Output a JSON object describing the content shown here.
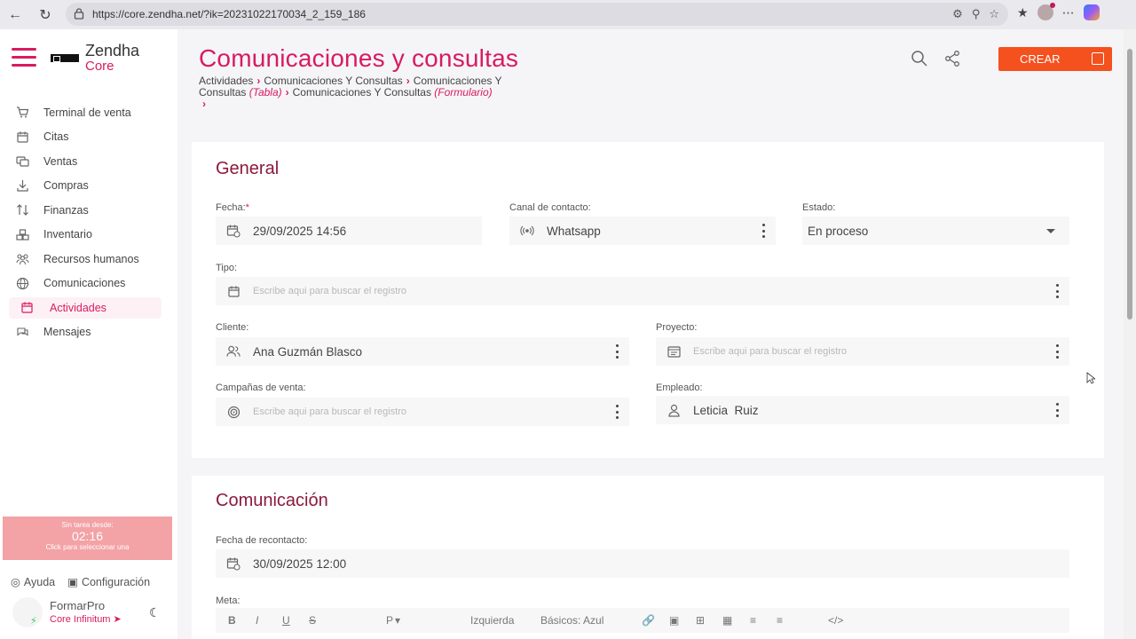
{
  "browser": {
    "url": "https://core.zendha.net/?ik=20231022170034_2_159_186"
  },
  "app": {
    "brand_name": "Zendha",
    "brand_sub": "Core"
  },
  "sidebar": {
    "items": [
      {
        "label": "Terminal de venta",
        "icon": "cart-icon"
      },
      {
        "label": "Citas",
        "icon": "calendar-icon"
      },
      {
        "label": "Ventas",
        "icon": "sales-icon"
      },
      {
        "label": "Compras",
        "icon": "download-icon"
      },
      {
        "label": "Finanzas",
        "icon": "transfer-icon"
      },
      {
        "label": "Inventario",
        "icon": "boxes-icon"
      },
      {
        "label": "Recursos humanos",
        "icon": "people-icon"
      },
      {
        "label": "Comunicaciones",
        "icon": "globe-icon"
      },
      {
        "label": "Actividades",
        "icon": "calendar-icon",
        "active": true
      },
      {
        "label": "Mensajes",
        "icon": "chat-icon"
      }
    ],
    "timer": {
      "line1": "Sin tarea desde:",
      "time": "02:16",
      "line3": "Click para seleccionar una"
    },
    "help_label": "Ayuda",
    "config_label": "Configuración",
    "user_name": "FormarPro",
    "user_plan": "Core Infinitum"
  },
  "header": {
    "title": "Comunicaciones y consultas",
    "breadcrumb": {
      "c1": "Actividades",
      "c2": "Comunicaciones Y Consultas",
      "c3a": "Comunicaciones Y",
      "c3b": "Consultas",
      "c3tag": "(Tabla)",
      "c4": "Comunicaciones Y Consultas",
      "c4tag": "(Formulario)"
    },
    "create_label": "CREAR"
  },
  "general": {
    "title": "General",
    "fecha_label": "Fecha:",
    "fecha_req": "*",
    "fecha_value": "29/09/2025 14:56",
    "canal_label": "Canal de contacto:",
    "canal_value": "Whatsapp",
    "estado_label": "Estado:",
    "estado_value": "En proceso",
    "tipo_label": "Tipo:",
    "tipo_placeholder": "Escribe aqui para buscar el registro",
    "cliente_label": "Cliente:",
    "cliente_value": "Ana Guzmán Blasco",
    "proyecto_label": "Proyecto:",
    "proyecto_placeholder": "Escribe aqui para buscar el registro",
    "campanas_label": "Campañas de venta:",
    "campanas_placeholder": "Escribe aqui para buscar el registro",
    "empleado_label": "Empleado:",
    "empleado_value": "Leticia  Ruiz"
  },
  "comunicacion": {
    "title": "Comunicación",
    "recontacto_label": "Fecha de recontacto:",
    "recontacto_value": "30/09/2025 12:00",
    "meta_label": "Meta:",
    "toolbar": {
      "bold": "B",
      "italic": "I",
      "underline": "U",
      "strike": "S",
      "paragraph": "P",
      "align": "Izquierda",
      "font": "Básicos: Azul"
    }
  }
}
